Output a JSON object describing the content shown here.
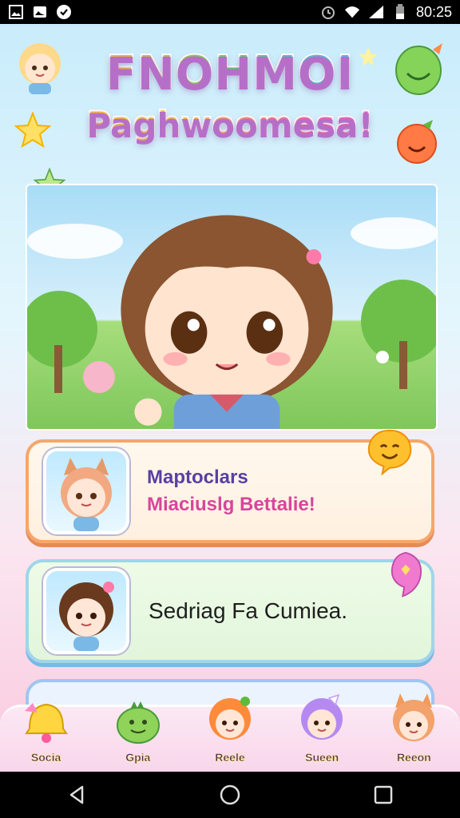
{
  "status_bar": {
    "time": "80:25",
    "left_icons": [
      "gallery-icon",
      "photo-icon",
      "shield-check-icon"
    ],
    "right_icons": [
      "alarm-icon",
      "wifi-icon",
      "signal-icon",
      "battery-icon"
    ]
  },
  "app": {
    "title_line1": "FNOHMOI",
    "title_line2": "Paghwoomesa!",
    "cards": [
      {
        "title": "Maptoclars",
        "subtitle": "Miaciuslg Bettalie!"
      },
      {
        "title": "Sedriag Fa Cumiea."
      }
    ],
    "bottom_nav": [
      {
        "label": "Socia",
        "icon": "bell-icon"
      },
      {
        "label": "Gpia",
        "icon": "dino-icon"
      },
      {
        "label": "Reele",
        "icon": "girl-icon"
      },
      {
        "label": "Sueen",
        "icon": "purple-girl-icon"
      },
      {
        "label": "Reeon",
        "icon": "cat-girl-icon"
      }
    ]
  },
  "system_nav": {
    "buttons": [
      "back-icon",
      "home-icon",
      "recents-icon"
    ]
  },
  "colors": {
    "accent_pink": "#ff6fb3",
    "card1_border": "#f6a66a",
    "card2_border": "#9fd6e9",
    "title_purple": "#5a3fa1"
  }
}
